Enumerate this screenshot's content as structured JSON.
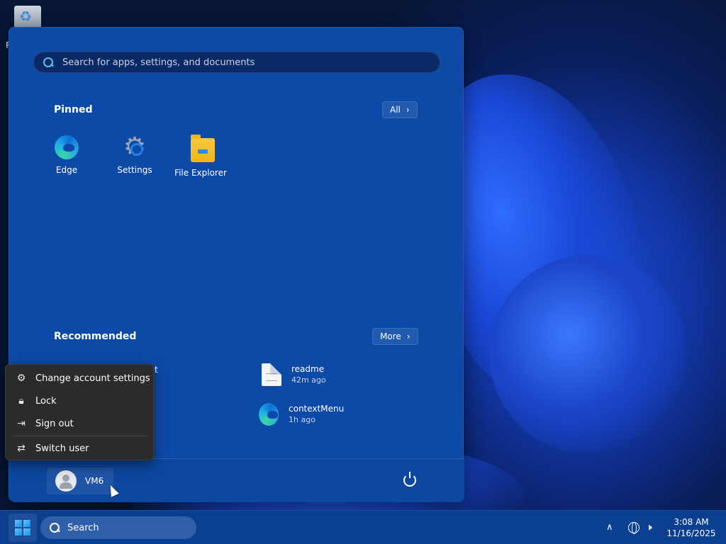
{
  "desktop": {
    "recycle_bin_label": "R"
  },
  "start_menu": {
    "search": {
      "placeholder": "Search for apps, settings, and documents"
    },
    "pinned": {
      "title": "Pinned",
      "all_label": "All",
      "apps": [
        {
          "label": "Edge",
          "icon": "edge-icon"
        },
        {
          "label": "Settings",
          "icon": "gear-icon"
        },
        {
          "label": "File Explorer",
          "icon": "folder-icon"
        }
      ]
    },
    "recommended": {
      "title": "Recommended",
      "more_label": "More",
      "partial_item_name": "ent",
      "items": [
        {
          "name": "readme",
          "time": "42m ago",
          "icon": "document-icon"
        },
        {
          "name": "contextMenu",
          "time": "1h ago",
          "icon": "edge-icon"
        }
      ]
    },
    "footer": {
      "user_name": "VM6",
      "power_icon": "power-icon"
    }
  },
  "context_menu": {
    "items": [
      {
        "label": "Change account settings",
        "icon": "account-settings-icon"
      },
      {
        "label": "Lock",
        "icon": "lock-icon"
      },
      {
        "label": "Sign out",
        "icon": "sign-out-icon"
      },
      {
        "label": "Switch user",
        "icon": "switch-user-icon"
      }
    ]
  },
  "taskbar": {
    "search_label": "Search",
    "time": "3:08 AM",
    "date": "11/16/2025"
  }
}
